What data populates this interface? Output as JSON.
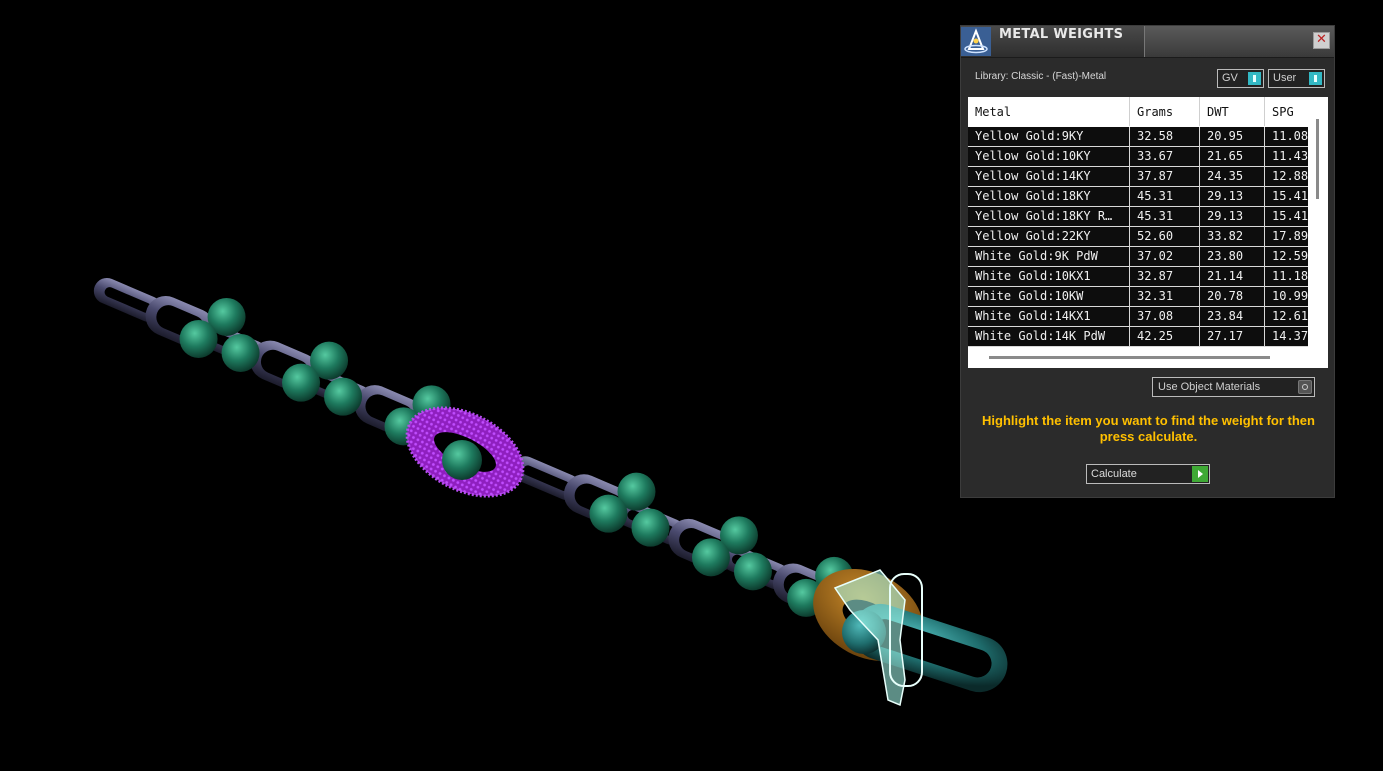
{
  "panel": {
    "title": "METAL WEIGHTS",
    "close_icon": "close-icon",
    "app_icon": "jewelry-tool-icon",
    "library_label": "Library: Classic - (Fast)-Metal",
    "toggle_gv_label": "GV",
    "toggle_user_label": "User",
    "table": {
      "columns": [
        "Metal",
        "Grams",
        "DWT",
        "SPG"
      ],
      "rows": [
        [
          "Yellow Gold:9KY",
          "32.58",
          "20.95",
          "11.08"
        ],
        [
          "Yellow Gold:10KY",
          "33.67",
          "21.65",
          "11.43"
        ],
        [
          "Yellow Gold:14KY",
          "37.87",
          "24.35",
          "12.88"
        ],
        [
          "Yellow Gold:18KY",
          "45.31",
          "29.13",
          "15.41"
        ],
        [
          "Yellow Gold:18KY R…",
          "45.31",
          "29.13",
          "15.41"
        ],
        [
          "Yellow Gold:22KY",
          "52.60",
          "33.82",
          "17.89"
        ],
        [
          "White Gold:9K PdW",
          "37.02",
          "23.80",
          "12.59"
        ],
        [
          "White Gold:10KX1",
          "32.87",
          "21.14",
          "11.18"
        ],
        [
          "White Gold:10KW",
          "32.31",
          "20.78",
          "10.99"
        ],
        [
          "White Gold:14KX1",
          "37.08",
          "23.84",
          "12.61"
        ],
        [
          "White Gold:14K PdW",
          "42.25",
          "27.17",
          "14.37"
        ]
      ]
    },
    "use_materials_label": "Use Object Materials",
    "instruction": "Highlight the item you want to find the weight for then press calculate.",
    "calculate_label": "Calculate"
  },
  "colors": {
    "link_dark": "#4a4a6e",
    "bead": "#1e7a5e",
    "selected_link": "#9a20c8",
    "gold_link": "#9a6418",
    "teal_link": "#1f6e6e",
    "highlight_cyan": "#a8fff0",
    "instruction": "#ffc000"
  }
}
